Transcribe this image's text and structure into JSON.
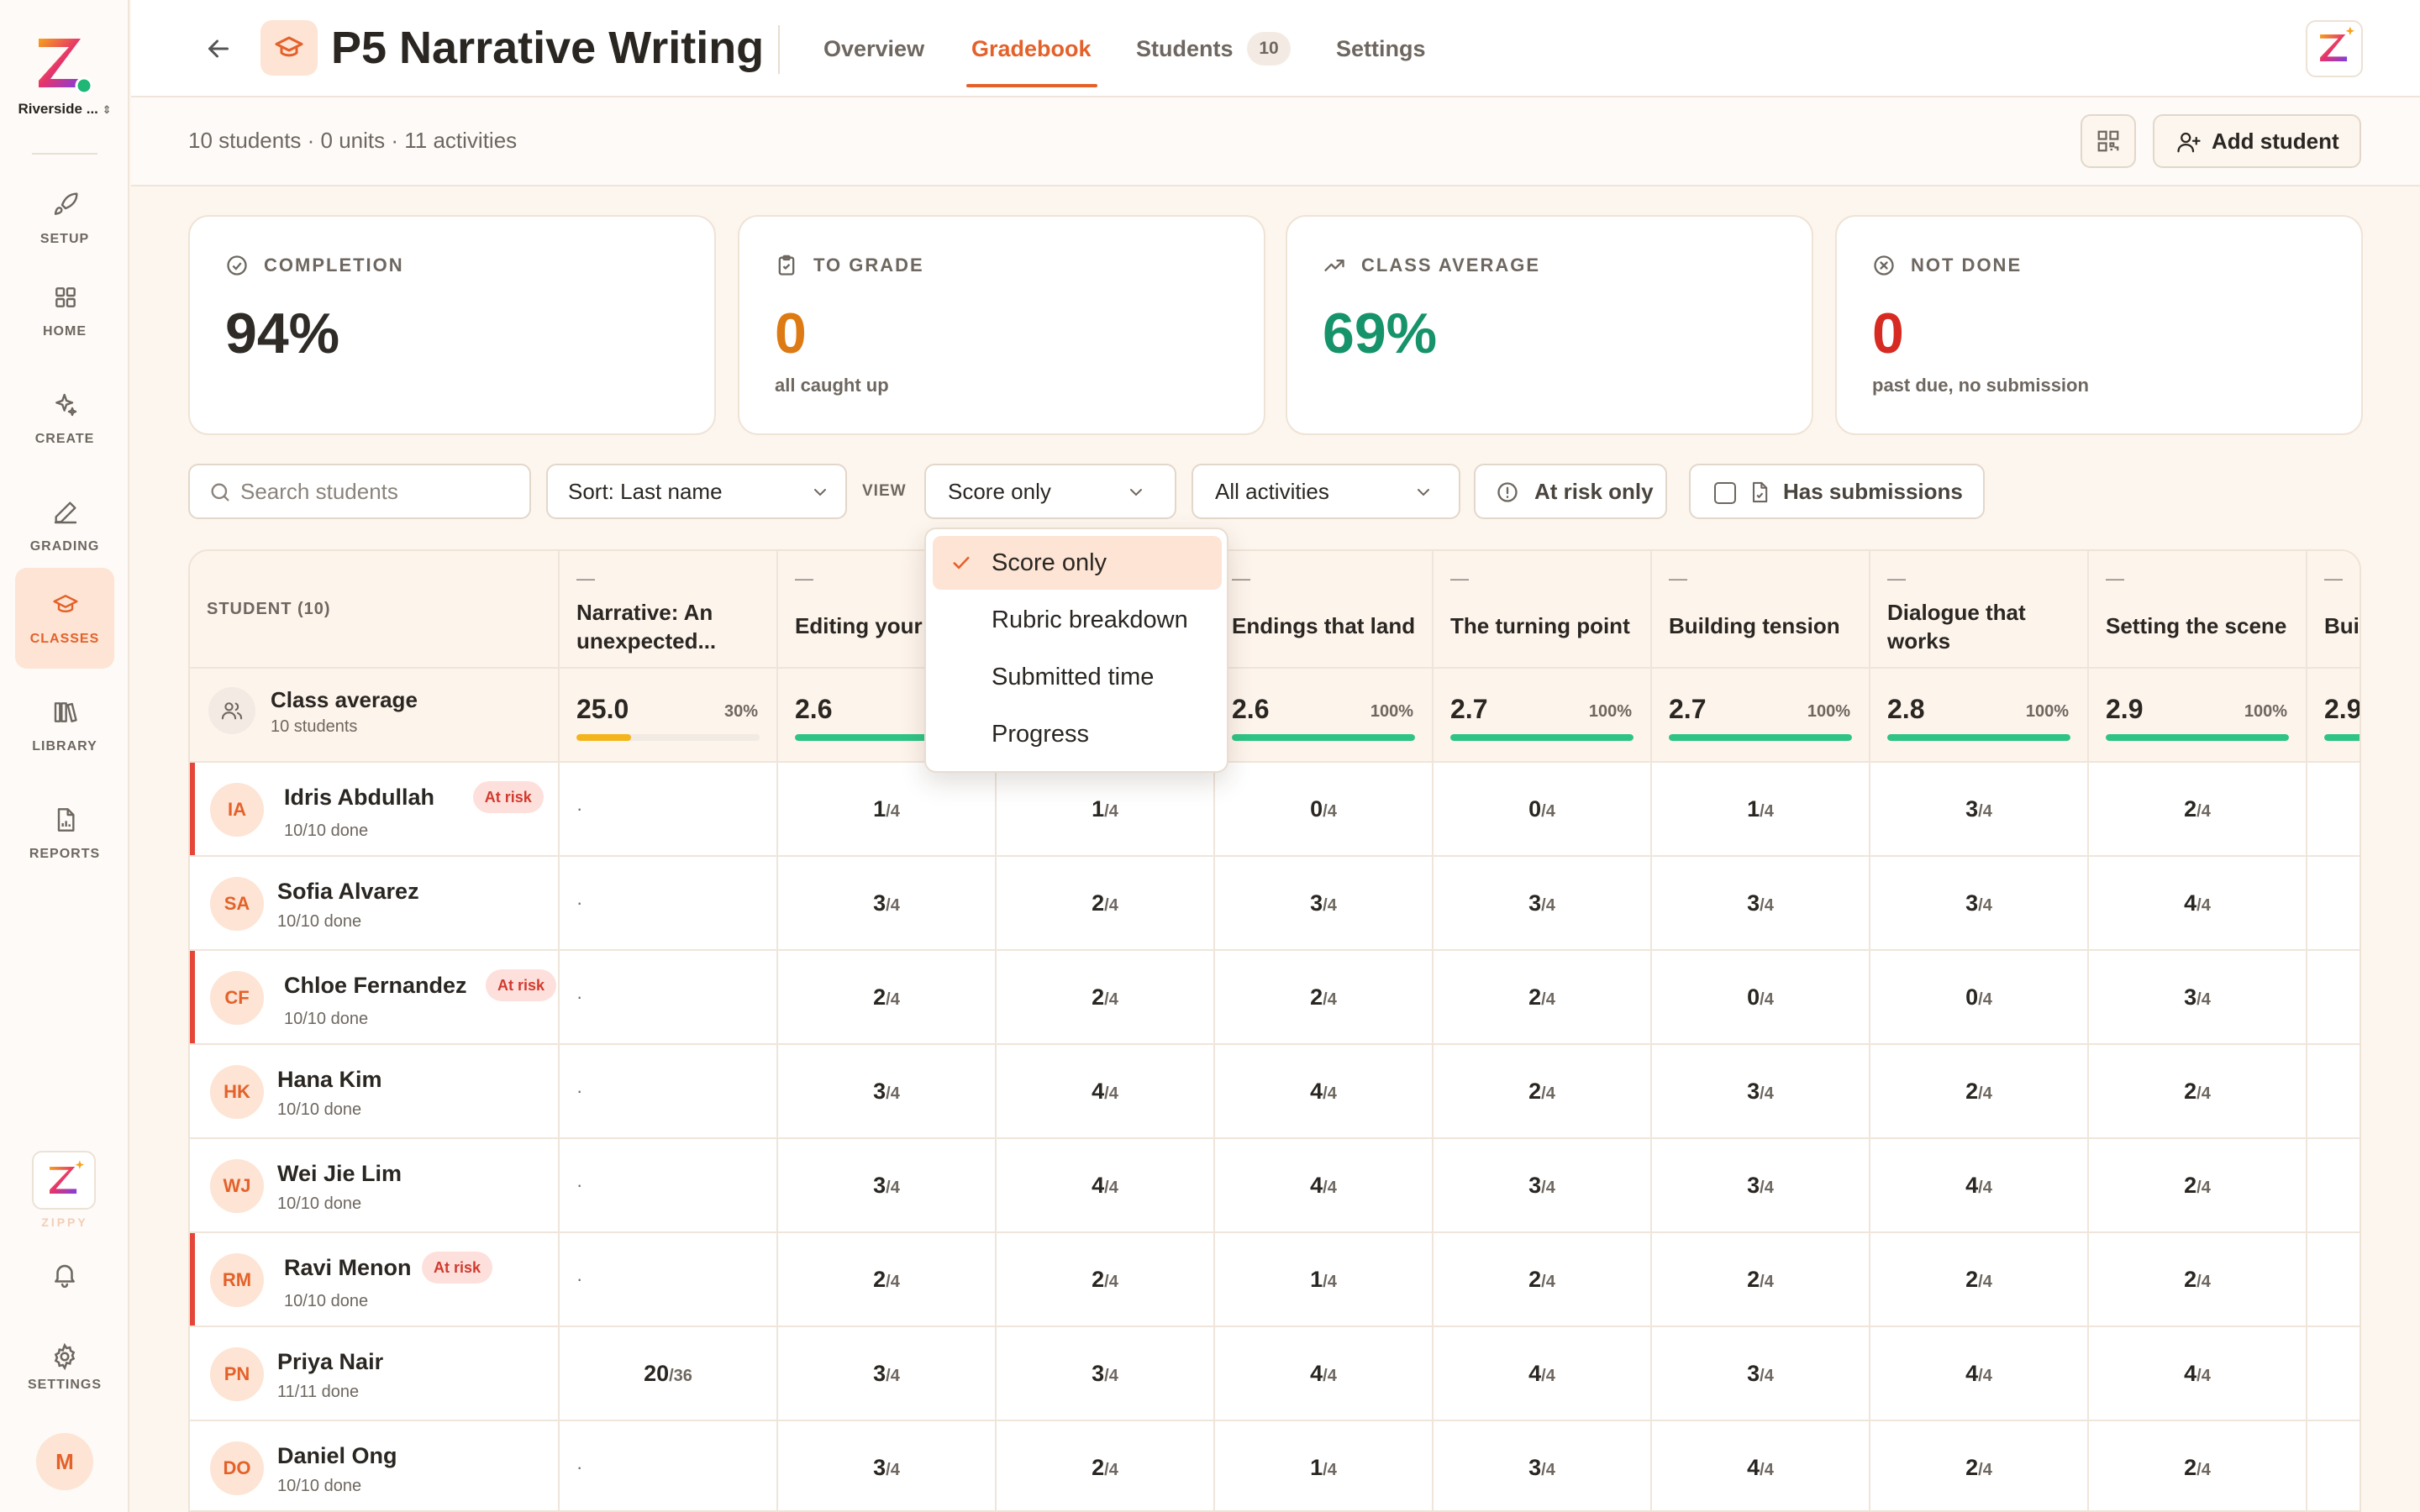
{
  "sidebar": {
    "org_name": "Riverside ...",
    "nav": [
      {
        "label": "SETUP",
        "icon": "rocket-icon"
      },
      {
        "label": "HOME",
        "icon": "grid-icon"
      },
      {
        "label": "CREATE",
        "icon": "sparkle-icon"
      },
      {
        "label": "GRADING",
        "icon": "pen-icon"
      },
      {
        "label": "CLASSES",
        "icon": "graduation-cap-icon"
      },
      {
        "label": "LIBRARY",
        "icon": "books-icon"
      },
      {
        "label": "REPORTS",
        "icon": "report-icon"
      }
    ],
    "active_nav": "CLASSES",
    "zippy_label": "ZIPPY",
    "settings_label": "SETTINGS",
    "user_initial": "M"
  },
  "header": {
    "class_title": "P5 Narrative Writing",
    "tabs": [
      {
        "label": "Overview"
      },
      {
        "label": "Gradebook"
      },
      {
        "label": "Students"
      },
      {
        "label": "Settings"
      }
    ],
    "active_tab": "Gradebook",
    "students_count": "10"
  },
  "subbar": {
    "meta": "10 students · 0 units · 11 activities",
    "add_student_label": "Add student"
  },
  "stats": [
    {
      "label": "COMPLETION",
      "value": "94%",
      "sub": "",
      "color": "#2f2b27",
      "icon": "check-circle-icon"
    },
    {
      "label": "TO GRADE",
      "value": "0",
      "sub": "all caught up",
      "color": "#de7a14",
      "icon": "clipboard-icon"
    },
    {
      "label": "CLASS AVERAGE",
      "value": "69%",
      "sub": "",
      "color": "#16936a",
      "icon": "trend-up-icon"
    },
    {
      "label": "NOT DONE",
      "value": "0",
      "sub": "past due, no submission",
      "color": "#d62a22",
      "icon": "x-circle-icon"
    }
  ],
  "filters": {
    "search_placeholder": "Search students",
    "sort_label": "Sort: Last name",
    "view_label": "VIEW",
    "view_selected": "Score only",
    "activities_label": "All activities",
    "at_risk_label": "At risk only",
    "has_submissions_label": "Has submissions"
  },
  "view_menu": {
    "options": [
      "Score only",
      "Rubric breakdown",
      "Submitted time",
      "Progress"
    ],
    "selected_index": 0
  },
  "gradebook": {
    "student_header": "STUDENT (10)",
    "columns": [
      {
        "dash": "—",
        "title": "Narrative: An unexpected...",
        "avg": "25.0",
        "pct": "30%",
        "fill": 0.3,
        "bar_color": "#f4b41c"
      },
      {
        "dash": "—",
        "title": "Editing your work",
        "avg": "2.6",
        "pct": "100%",
        "fill": 1.0,
        "bar_color": "#2fc486"
      },
      {
        "dash": "—",
        "title": "",
        "avg": "",
        "pct": "",
        "fill": 1.0,
        "bar_color": "#2fc486"
      },
      {
        "dash": "—",
        "title": "Endings that land",
        "avg": "2.6",
        "pct": "100%",
        "fill": 1.0,
        "bar_color": "#2fc486"
      },
      {
        "dash": "—",
        "title": "The turning point",
        "avg": "2.7",
        "pct": "100%",
        "fill": 1.0,
        "bar_color": "#2fc486"
      },
      {
        "dash": "—",
        "title": "Building tension",
        "avg": "2.7",
        "pct": "100%",
        "fill": 1.0,
        "bar_color": "#2fc486"
      },
      {
        "dash": "—",
        "title": "Dialogue that works",
        "avg": "2.8",
        "pct": "100%",
        "fill": 1.0,
        "bar_color": "#2fc486"
      },
      {
        "dash": "—",
        "title": "Setting the scene",
        "avg": "2.9",
        "pct": "100%",
        "fill": 1.0,
        "bar_color": "#2fc486"
      },
      {
        "dash": "—",
        "title": "Building cha",
        "avg": "2.9",
        "pct": "",
        "fill": 1.0,
        "bar_color": "#2fc486"
      }
    ],
    "class_average": {
      "label": "Class average",
      "sub": "10 students"
    },
    "students": [
      {
        "initials": "IA",
        "name": "Idris Abdullah",
        "done": "10/10 done",
        "at_risk": true,
        "risk_label": "At risk",
        "scores": [
          {
            "n": "·",
            "d": ""
          },
          {
            "n": "1",
            "d": "/4"
          },
          {
            "n": "1",
            "d": "/4"
          },
          {
            "n": "0",
            "d": "/4"
          },
          {
            "n": "0",
            "d": "/4"
          },
          {
            "n": "1",
            "d": "/4"
          },
          {
            "n": "3",
            "d": "/4"
          },
          {
            "n": "2",
            "d": "/4"
          }
        ]
      },
      {
        "initials": "SA",
        "name": "Sofia Alvarez",
        "done": "10/10 done",
        "at_risk": false,
        "risk_label": "",
        "scores": [
          {
            "n": "·",
            "d": ""
          },
          {
            "n": "3",
            "d": "/4"
          },
          {
            "n": "2",
            "d": "/4"
          },
          {
            "n": "3",
            "d": "/4"
          },
          {
            "n": "3",
            "d": "/4"
          },
          {
            "n": "3",
            "d": "/4"
          },
          {
            "n": "3",
            "d": "/4"
          },
          {
            "n": "4",
            "d": "/4"
          }
        ]
      },
      {
        "initials": "CF",
        "name": "Chloe Fernandez",
        "done": "10/10 done",
        "at_risk": true,
        "risk_label": "At risk",
        "scores": [
          {
            "n": "·",
            "d": ""
          },
          {
            "n": "2",
            "d": "/4"
          },
          {
            "n": "2",
            "d": "/4"
          },
          {
            "n": "2",
            "d": "/4"
          },
          {
            "n": "2",
            "d": "/4"
          },
          {
            "n": "0",
            "d": "/4"
          },
          {
            "n": "0",
            "d": "/4"
          },
          {
            "n": "3",
            "d": "/4"
          }
        ]
      },
      {
        "initials": "HK",
        "name": "Hana Kim",
        "done": "10/10 done",
        "at_risk": false,
        "risk_label": "",
        "scores": [
          {
            "n": "·",
            "d": ""
          },
          {
            "n": "3",
            "d": "/4"
          },
          {
            "n": "4",
            "d": "/4"
          },
          {
            "n": "4",
            "d": "/4"
          },
          {
            "n": "2",
            "d": "/4"
          },
          {
            "n": "3",
            "d": "/4"
          },
          {
            "n": "2",
            "d": "/4"
          },
          {
            "n": "2",
            "d": "/4"
          }
        ]
      },
      {
        "initials": "WJ",
        "name": "Wei Jie Lim",
        "done": "10/10 done",
        "at_risk": false,
        "risk_label": "",
        "scores": [
          {
            "n": "·",
            "d": ""
          },
          {
            "n": "3",
            "d": "/4"
          },
          {
            "n": "4",
            "d": "/4"
          },
          {
            "n": "4",
            "d": "/4"
          },
          {
            "n": "3",
            "d": "/4"
          },
          {
            "n": "3",
            "d": "/4"
          },
          {
            "n": "4",
            "d": "/4"
          },
          {
            "n": "2",
            "d": "/4"
          }
        ]
      },
      {
        "initials": "RM",
        "name": "Ravi Menon",
        "done": "10/10 done",
        "at_risk": true,
        "risk_label": "At risk",
        "scores": [
          {
            "n": "·",
            "d": ""
          },
          {
            "n": "2",
            "d": "/4"
          },
          {
            "n": "2",
            "d": "/4"
          },
          {
            "n": "1",
            "d": "/4"
          },
          {
            "n": "2",
            "d": "/4"
          },
          {
            "n": "2",
            "d": "/4"
          },
          {
            "n": "2",
            "d": "/4"
          },
          {
            "n": "2",
            "d": "/4"
          }
        ]
      },
      {
        "initials": "PN",
        "name": "Priya Nair",
        "done": "11/11 done",
        "at_risk": false,
        "risk_label": "",
        "scores": [
          {
            "n": "20",
            "d": "/36"
          },
          {
            "n": "3",
            "d": "/4"
          },
          {
            "n": "3",
            "d": "/4"
          },
          {
            "n": "4",
            "d": "/4"
          },
          {
            "n": "4",
            "d": "/4"
          },
          {
            "n": "3",
            "d": "/4"
          },
          {
            "n": "4",
            "d": "/4"
          },
          {
            "n": "4",
            "d": "/4"
          }
        ]
      },
      {
        "initials": "DO",
        "name": "Daniel Ong",
        "done": "10/10 done",
        "at_risk": false,
        "risk_label": "",
        "scores": [
          {
            "n": "·",
            "d": ""
          },
          {
            "n": "3",
            "d": "/4"
          },
          {
            "n": "2",
            "d": "/4"
          },
          {
            "n": "1",
            "d": "/4"
          },
          {
            "n": "3",
            "d": "/4"
          },
          {
            "n": "4",
            "d": "/4"
          },
          {
            "n": "2",
            "d": "/4"
          },
          {
            "n": "2",
            "d": "/4"
          }
        ]
      }
    ]
  }
}
